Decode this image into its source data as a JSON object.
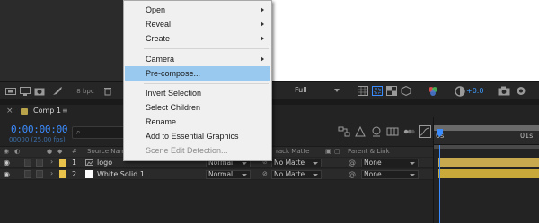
{
  "context_menu": {
    "items": [
      {
        "label": "Open",
        "submenu": true
      },
      {
        "label": "Reveal",
        "submenu": true
      },
      {
        "label": "Create",
        "submenu": true
      },
      {
        "label": "Camera",
        "submenu": true
      },
      {
        "label": "Pre-compose...",
        "highlighted": true
      },
      {
        "label": "Invert Selection"
      },
      {
        "label": "Select Children"
      },
      {
        "label": "Rename"
      },
      {
        "label": "Add to Essential Graphics"
      },
      {
        "label": "Scene Edit Detection...",
        "disabled": true
      }
    ]
  },
  "viewer_toolbar": {
    "bit_depth": "8 bpc",
    "resolution": "Full",
    "exposure": "+0.0",
    "icons": [
      "always-preview-icon",
      "monitor-icon",
      "snapshot-icon",
      "rocket-icon",
      "trash-icon",
      "grid-icon",
      "region-icon",
      "transparency-icon",
      "3d-icon",
      "color-channels-icon",
      "exposure-reset-icon",
      "camera-snapshot-icon",
      "show-snapshot-icon"
    ]
  },
  "comp_tab": {
    "label": "Comp 1",
    "swatch_color": "#b9a34a"
  },
  "timeline": {
    "current_time": "0:00:00:00",
    "fps": "00000 (25.00 fps)",
    "search_glyph": "⌕",
    "columns": [
      "Source Name",
      "rack Matte",
      "Parent & Link"
    ],
    "ruler_labels": [
      "0s",
      "01s"
    ],
    "layers": [
      {
        "index": "1",
        "name": "logo",
        "mode": "Normal",
        "matte": "No Matte",
        "parent": "None",
        "label_color": "#e8c24a",
        "bar_color": "#c9a94e"
      },
      {
        "index": "2",
        "name": "White Solid 1",
        "mode": "Normal",
        "matte": "No Matte",
        "parent": "None",
        "label_color": "#e8c24a",
        "bar_color": "#c8a93a"
      }
    ]
  },
  "colors": {
    "accent_blue": "#3b8cff",
    "menu_highlight": "#99c9ef"
  }
}
